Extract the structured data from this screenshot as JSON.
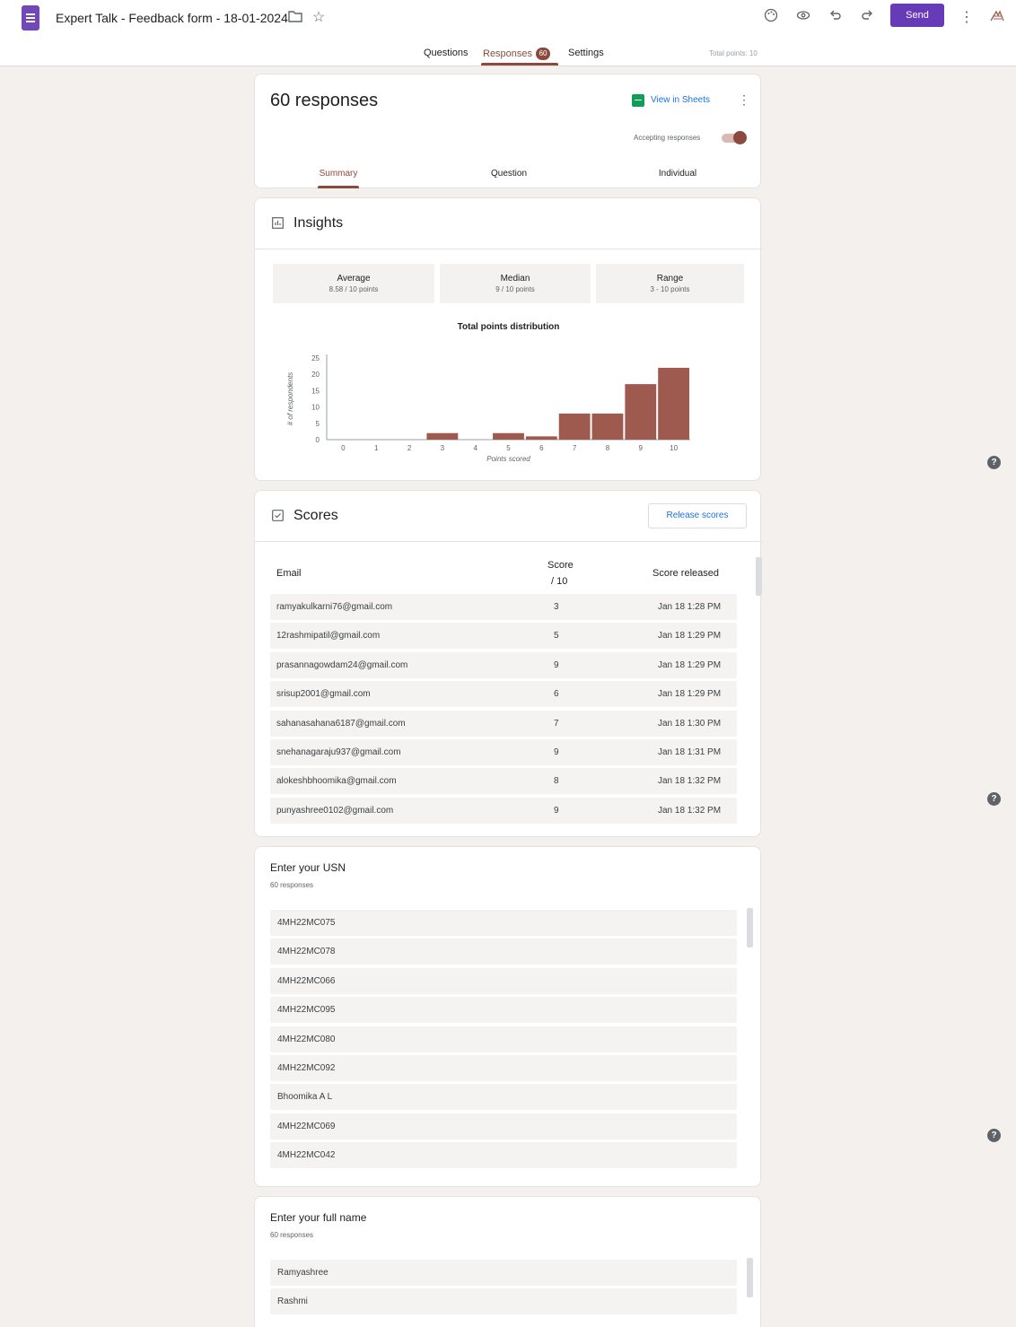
{
  "header": {
    "title": "Expert Talk - Feedback form - 18-01-2024",
    "folder_icon": "folder-icon",
    "star_icon": "star-icon",
    "send_label": "Send",
    "tabs": [
      {
        "label": "Questions"
      },
      {
        "label": "Responses",
        "badge": "60"
      },
      {
        "label": "Settings"
      }
    ],
    "total_points": "Total points: 10"
  },
  "summary": {
    "title": "60 responses",
    "view_sheets": "View in Sheets",
    "accepting": "Accepting responses",
    "accepting_on": true,
    "subtabs": [
      "Summary",
      "Question",
      "Individual"
    ]
  },
  "insights": {
    "title": "Insights",
    "stats": [
      {
        "label": "Average",
        "value": "8.58 / 10 points"
      },
      {
        "label": "Median",
        "value": "9 / 10 points"
      },
      {
        "label": "Range",
        "value": "3 - 10 points"
      }
    ],
    "chart_data": {
      "type": "bar",
      "title": "Total points distribution",
      "xlabel": "Points scored",
      "ylabel": "# of respondents",
      "categories": [
        0,
        1,
        2,
        3,
        4,
        5,
        6,
        7,
        8,
        9,
        10
      ],
      "values": [
        0,
        0,
        0,
        2,
        0,
        2,
        1,
        8,
        8,
        17,
        22
      ],
      "yticks": [
        0,
        5,
        10,
        15,
        20,
        25
      ],
      "ylim": [
        0,
        25
      ],
      "color": "#9e5a4e"
    }
  },
  "scores": {
    "title": "Scores",
    "release_label": "Release scores",
    "col_email": "Email",
    "col_score": "Score",
    "col_score_sub": "/ 10",
    "col_released": "Score released",
    "rows": [
      {
        "email": "ramyakulkarni76@gmail.com",
        "score": "3",
        "released": "Jan 18 1:28 PM"
      },
      {
        "email": "12rashmipatil@gmail.com",
        "score": "5",
        "released": "Jan 18 1:29 PM"
      },
      {
        "email": "prasannagowdam24@gmail.com",
        "score": "9",
        "released": "Jan 18 1:29 PM"
      },
      {
        "email": "srisup2001@gmail.com",
        "score": "6",
        "released": "Jan 18 1:29 PM"
      },
      {
        "email": "sahanasahana6187@gmail.com",
        "score": "7",
        "released": "Jan 18 1:30 PM"
      },
      {
        "email": "snehanagaraju937@gmail.com",
        "score": "9",
        "released": "Jan 18 1:31 PM"
      },
      {
        "email": "alokeshbhoomika@gmail.com",
        "score": "8",
        "released": "Jan 18 1:32 PM"
      },
      {
        "email": "punyashree0102@gmail.com",
        "score": "9",
        "released": "Jan 18 1:32 PM"
      }
    ]
  },
  "usn": {
    "title": "Enter your USN",
    "count": "60 responses",
    "answers": [
      "4MH22MC075",
      "4MH22MC078",
      "4MH22MC066",
      "4MH22MC095",
      "4MH22MC080",
      "4MH22MC092",
      "Bhoomika A L",
      "4MH22MC069",
      "4MH22MC042"
    ]
  },
  "fullname": {
    "title": "Enter your full name",
    "count": "60 responses",
    "answers": [
      "Ramyashree",
      "Rashmi"
    ]
  }
}
